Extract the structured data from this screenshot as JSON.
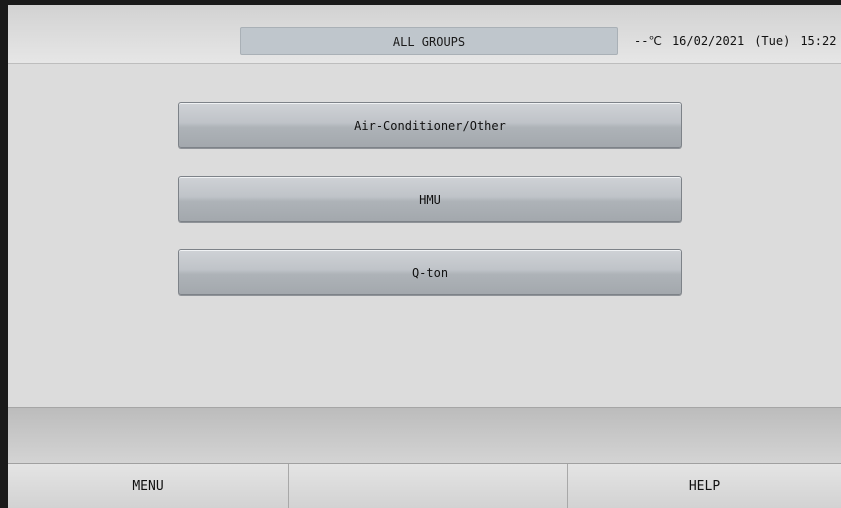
{
  "header": {
    "group_title": "ALL GROUPS",
    "temperature": "--℃",
    "date": "16/02/2021",
    "weekday": "(Tue)",
    "time": "15:22"
  },
  "menu": {
    "items": [
      {
        "label": "Air-Conditioner/Other"
      },
      {
        "label": "HMU"
      },
      {
        "label": "Q-ton"
      }
    ]
  },
  "footer": {
    "left_label": "MENU",
    "center_label": "",
    "right_label": "HELP"
  }
}
